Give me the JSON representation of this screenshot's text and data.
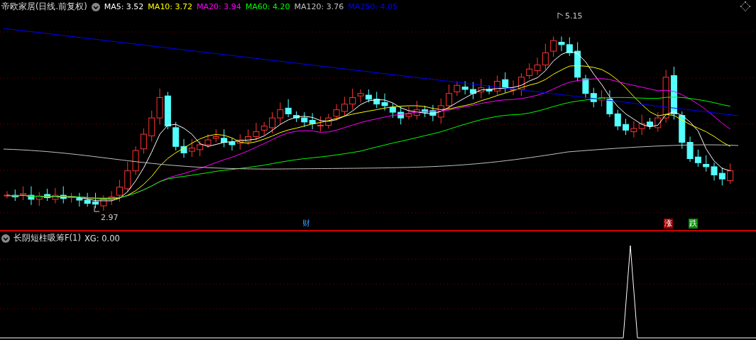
{
  "main_panel": {
    "title": "帝欧家居(日线.前复权)",
    "moving_averages": [
      {
        "label": "MA5:",
        "value": "3.52",
        "color": "#ffffff"
      },
      {
        "label": "MA10:",
        "value": "3.72",
        "color": "#ffff00"
      },
      {
        "label": "MA20:",
        "value": "3.94",
        "color": "#ff00ff"
      },
      {
        "label": "MA60:",
        "value": "4.20",
        "color": "#00ff00"
      },
      {
        "label": "MA120:",
        "value": "3.76",
        "color": "#c0c0c0"
      },
      {
        "label": "MA250:",
        "value": "4.05",
        "color": "#0000ff"
      }
    ],
    "high_label": "5.15",
    "low_label": "2.97",
    "markers": [
      {
        "text": "财",
        "kind": "plain"
      },
      {
        "text": "涨",
        "kind": "boxed",
        "color": "#990000"
      },
      {
        "text": "跌",
        "kind": "boxed",
        "color": "#008800"
      }
    ]
  },
  "indicator_panel": {
    "title": "长阴短柱吸筹F(1)",
    "readout": "XG: 0.00"
  }
}
